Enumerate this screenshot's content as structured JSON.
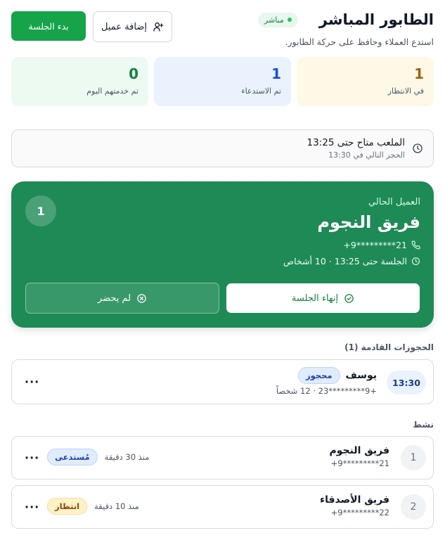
{
  "header": {
    "title": "الطابور المباشر",
    "live_badge": "مباشر",
    "subtitle": "استدع العملاء وحافظ على حركة الطابور.",
    "add_customer_label": "إضافة عميل",
    "start_session_label": "بدء الجلسة"
  },
  "stats": [
    {
      "value": "1",
      "label": "في الانتظار"
    },
    {
      "value": "1",
      "label": "تم الاستدعاء"
    },
    {
      "value": "0",
      "label": "تم خدمتهم اليوم"
    }
  ],
  "availability": {
    "line1": "الملعب متاح حتى 13:25",
    "line2": "الحجز التالي في 13:30"
  },
  "current": {
    "label": "العميل الحالي",
    "name": "فريق النجوم",
    "phone": "+9*********21",
    "session": "الجلسة حتى 13:25 · 10 أشخاص",
    "number": "1",
    "end_label": "إنهاء الجلسة",
    "noshow_label": "لم يحضر"
  },
  "upcoming": {
    "heading": "الحجوزات القادمة (1)",
    "items": [
      {
        "time": "13:30",
        "name": "يوسف",
        "status": "محجوز",
        "sub": "+9*********23 · 12 شخصاً",
        "more": "···"
      }
    ]
  },
  "active": {
    "heading": "نشط",
    "items": [
      {
        "position": "1",
        "name": "فريق النجوم",
        "phone": "+9*********21",
        "since": "منذ 30 دقيقة",
        "status": "مُستدعى",
        "more": "···"
      },
      {
        "position": "2",
        "name": "فريق الأصدقاء",
        "phone": "+9*********22",
        "since": "منذ 10 دقيقة",
        "status": "انتظار",
        "more": "···"
      }
    ]
  },
  "colors": {
    "primary": "#16a34a",
    "current_card": "#1e8a55",
    "waiting_bg": "#fef9e7",
    "called_bg": "#eaf2fe",
    "served_bg": "#edfaf1"
  }
}
